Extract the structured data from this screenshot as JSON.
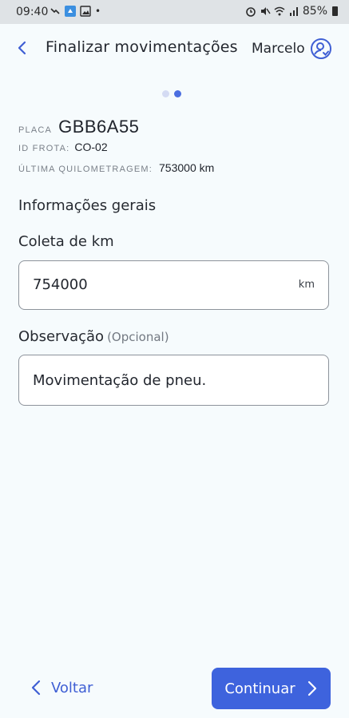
{
  "statusbar": {
    "time": "09:40",
    "battery": "85%"
  },
  "header": {
    "title": "Finalizar movimentações",
    "user": "Marcelo"
  },
  "stepper": {
    "current_step": 2,
    "total_steps": 2
  },
  "vehicle": {
    "placa_label": "PLACA",
    "placa_value": "GBB6A55",
    "frota_label": "ID FROTA:",
    "frota_value": "CO-02",
    "km_label": "ÚLTIMA QUILOMETRAGEM:",
    "km_value": "753000 km"
  },
  "section_title": "Informações gerais",
  "coleta": {
    "label": "Coleta de km",
    "value": "754000",
    "unit": "km"
  },
  "observacao": {
    "label": "Observação",
    "optional": "(Opcional)",
    "value": "Movimentação de pneu."
  },
  "footer": {
    "back_label": "Voltar",
    "continue_label": "Continuar"
  },
  "colors": {
    "primary": "#3e63dd",
    "background": "#f6fbfd",
    "dot_inactive": "#d4dbf3"
  }
}
